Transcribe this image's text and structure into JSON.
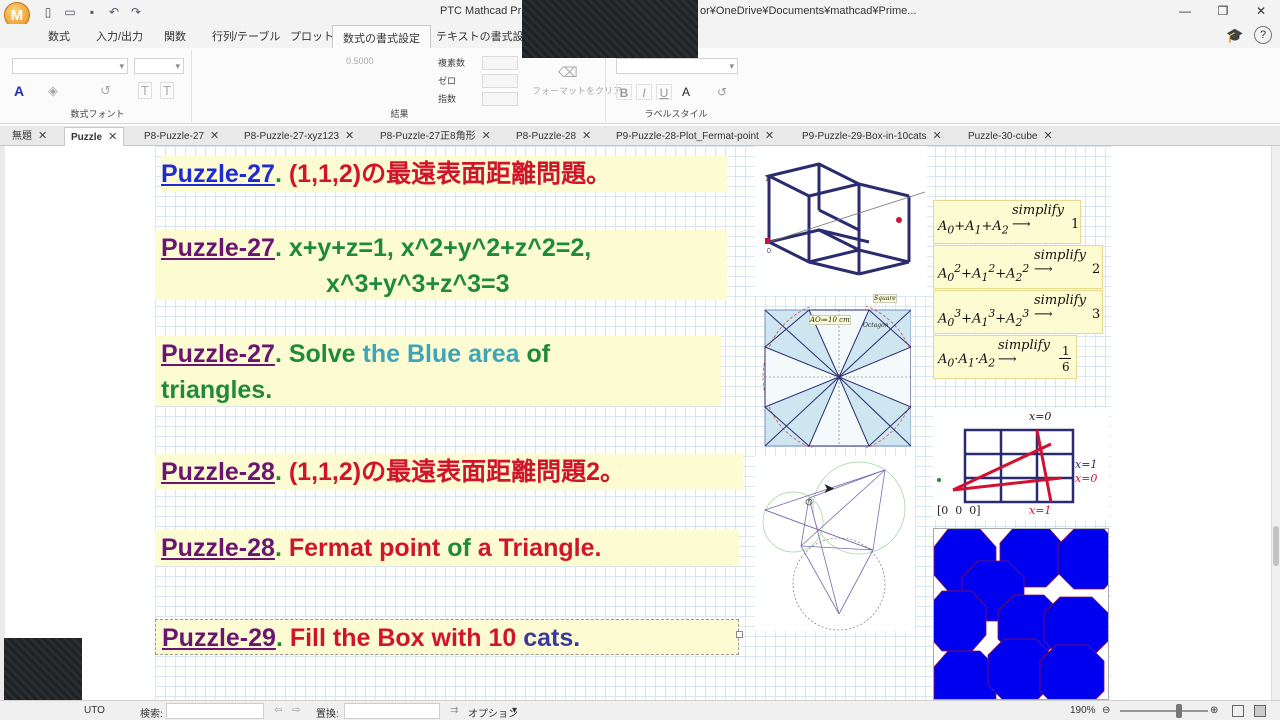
{
  "titlebar": {
    "logo": "M",
    "title_left": "PTC Mathcad Prim",
    "title_right": "or¥OneDrive¥Documents¥mathcad¥Prime...",
    "qat": [
      "new-icon",
      "open-icon",
      "save-icon",
      "undo-icon",
      "redo-icon"
    ]
  },
  "ribbon": {
    "tabs": [
      "数式",
      "入力/出力",
      "関数",
      "行列/テーブル",
      "プロット",
      "数式の書式設定",
      "テキストの書式設定"
    ],
    "active_tab": "数式の書式設定",
    "groups": {
      "math_font": "数式フォント",
      "result": "結果",
      "label_style": "ラベルスタイル"
    },
    "result_value": "0.5000",
    "complex_label": "複素数",
    "zero_label": "ゼロ",
    "exponent_label": "指数",
    "clear_format": "フォーマットをクリア",
    "bold": "B",
    "italic": "I",
    "underline": "U",
    "font_color": "A"
  },
  "doctabs": [
    {
      "label": "無題",
      "active": false
    },
    {
      "label": "Puzzle",
      "active": true
    },
    {
      "label": "P8-Puzzle-27",
      "active": false
    },
    {
      "label": "P8-Puzzle-27-xyz123",
      "active": false
    },
    {
      "label": "P8-Puzzle-27正8角形",
      "active": false
    },
    {
      "label": "P8-Puzzle-28",
      "active": false
    },
    {
      "label": "P9-Puzzle-28-Plot_Fermat-point",
      "active": false
    },
    {
      "label": "P9-Puzzle-29-Box-in-10cats",
      "active": false
    },
    {
      "label": "Puzzle-30-cube",
      "active": false
    }
  ],
  "regions": {
    "r1": {
      "link": "Puzzle-27",
      "dot": ".",
      "text": "(1,1,2)の最遠表面距離問題。"
    },
    "r2": {
      "link": "Puzzle-27",
      "dot": ".",
      "line1": "x+y+z=1, x^2+y^2+z^2=2,",
      "line2": "x^3+y^3+z^3=3"
    },
    "r3": {
      "link": "Puzzle-27",
      "dot": ".",
      "w1": "Solve",
      "w2": "the Blue area",
      "w3": "of",
      "w4": "triangles."
    },
    "r4": {
      "link": "Puzzle-28",
      "dot": ".",
      "text": "(1,1,2)の最遠表面距離問題2。"
    },
    "r5": {
      "link": "Puzzle-28",
      "dot": ".",
      "w1": "Fermat point",
      "w2": "of",
      "w3": "a Triangle."
    },
    "r6": {
      "link": "Puzzle-29",
      "dot": ".",
      "w1": "Fill the Box with 10",
      "w2": "cats."
    }
  },
  "math": {
    "simplify": "simplify",
    "eq1_result": "1",
    "eq2_result": "2",
    "eq3_result": "3",
    "eq4_num": "1",
    "eq4_den": "6"
  },
  "octagon": {
    "label_ao": "AO≔10 cm",
    "label_square": "Square",
    "label_octagon": "Octagon"
  },
  "grid_plot": {
    "x0": "x=0",
    "x1": "x=1",
    "x1r": "x=1",
    "x0r": "x=0",
    "origin": "[0  0  0]"
  },
  "cube": {
    "label1": "1",
    "label0": "0"
  },
  "statusbar": {
    "mode": "UTO",
    "search_label": "検索:",
    "replace_label": "置換:",
    "options_label": "オプション",
    "zoom": "190%"
  },
  "colors": {
    "accent_blue": "#1e2bd4",
    "purple": "#6a1570",
    "red": "#d0152b",
    "green": "#1f8a3b",
    "teal": "#3ea4b6",
    "octagon_fill": "#0000f0"
  }
}
